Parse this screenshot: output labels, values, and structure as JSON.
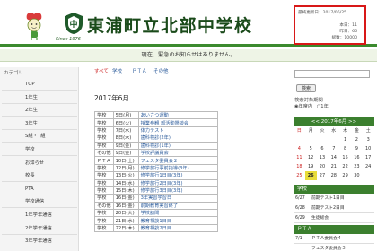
{
  "header": {
    "title": "東浦町立北部中学校",
    "since": "Since 1976",
    "update_label": "最終更新日：2017/06/25",
    "counters": [
      {
        "label": "本日：",
        "value": "11"
      },
      {
        "label": "昨日：",
        "value": "66"
      },
      {
        "label": "総数：",
        "value": "10000"
      }
    ]
  },
  "notice": "現在、緊急のお知らせはありません。",
  "sidebar": {
    "heading": "カテゴリ",
    "items": [
      "TOP",
      "1年生",
      "2年生",
      "3年生",
      "S組・T組",
      "学校",
      "お知らせ",
      "校長",
      "PTA",
      "学校通信",
      "1年学年通信",
      "2年学年通信",
      "3年学年通信",
      "学校保健便り"
    ]
  },
  "main": {
    "tabs": [
      "すべて",
      "学校",
      "ＰＴＡ",
      "その他"
    ],
    "month": "2017年6月",
    "events": [
      [
        "学校",
        "5日(月)",
        "あいさつ運動"
      ],
      [
        "学校",
        "6日(火)",
        "授業参観 部活動懇談会"
      ],
      [
        "学校",
        "7日(水)",
        "体力テスト"
      ],
      [
        "学校",
        "8日(木)",
        "歯科検診(2年)"
      ],
      [
        "学校",
        "9日(金)",
        "歯科検診(1年)"
      ],
      [
        "その他",
        "9日(金)",
        "学校評議員会"
      ],
      [
        "ＰＴＡ",
        "10日(土)",
        "フェスタ委員会２"
      ],
      [
        "学校",
        "12日(月)",
        "修学旅行事前指導(3年)"
      ],
      [
        "学校",
        "13日(火)",
        "修学旅行1日目(3年)"
      ],
      [
        "学校",
        "14日(水)",
        "修学旅行2日目(3年)"
      ],
      [
        "学校",
        "15日(木)",
        "修学旅行3日目(3年)"
      ],
      [
        "学校",
        "16日(金)",
        "3年実習学習日"
      ],
      [
        "その他",
        "16日(金)",
        "前期教育実習終了"
      ],
      [
        "学校",
        "20日(火)",
        "学校訪問"
      ],
      [
        "学校",
        "21日(水)",
        "教育相談1日目"
      ],
      [
        "学校",
        "22日(木)",
        "教育相談2日目"
      ]
    ]
  },
  "search": {
    "button": "検索",
    "target_label": "検索対象期間",
    "options": [
      "年度内",
      "1年"
    ]
  },
  "calendar": {
    "title": "<< 2017年6月 >>",
    "weekdays": [
      "日",
      "月",
      "火",
      "水",
      "木",
      "金",
      "土"
    ],
    "weeks": [
      [
        "",
        "",
        "",
        "",
        "1",
        "2",
        "3"
      ],
      [
        "4",
        "5",
        "6",
        "7",
        "8",
        "9",
        "10"
      ],
      [
        "11",
        "12",
        "13",
        "14",
        "15",
        "16",
        "17"
      ],
      [
        "18",
        "19",
        "20",
        "21",
        "22",
        "23",
        "24"
      ],
      [
        "25",
        "26",
        "27",
        "28",
        "29",
        "30",
        ""
      ]
    ],
    "today": "26"
  },
  "school_panel": {
    "heading": "学校",
    "rows": [
      [
        "6/27",
        "前期テスト1日目"
      ],
      [
        "6/28",
        "前期テスト2日目"
      ],
      [
        "6/29",
        "生徒総会"
      ]
    ]
  },
  "pta_panel": {
    "heading": "ＰＴＡ",
    "rows": [
      [
        "7/1",
        "ＰＴＡ委員会４"
      ],
      [
        "",
        "フェスタ委員会３"
      ]
    ]
  },
  "colors": {
    "brand_green": "#3b7f2e",
    "highlight_border": "#d81818",
    "today": "#e8dc3a"
  }
}
